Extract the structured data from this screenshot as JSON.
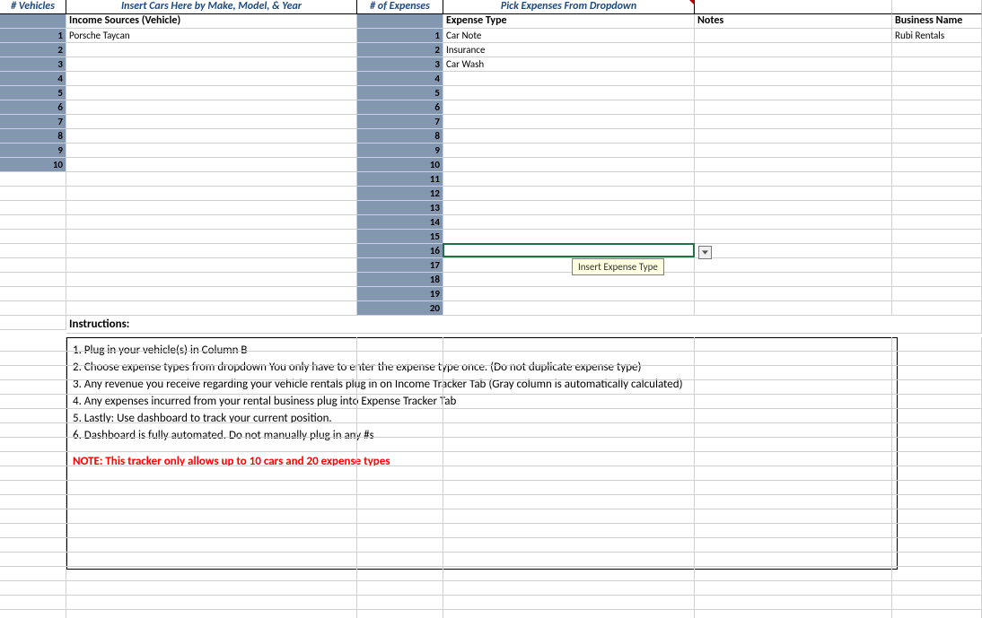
{
  "header1": {
    "vehicles": "# Vehicles",
    "insertCars": "Insert Cars Here by Make, Model, & Year",
    "numExpenses": "# of Expenses",
    "pickExpenses": "Pick Expenses From Dropdown"
  },
  "header2": {
    "incomeSources": "Income Sources (Vehicle)",
    "expenseType": "Expense Type",
    "notes": "Notes",
    "businessName": "Business Name"
  },
  "vehicles_numbers": [
    "1",
    "2",
    "3",
    "4",
    "5",
    "6",
    "7",
    "8",
    "9",
    "10"
  ],
  "vehicles_values": [
    "Porsche Taycan",
    "",
    "",
    "",
    "",
    "",
    "",
    "",
    "",
    ""
  ],
  "expense_numbers": [
    "1",
    "2",
    "3",
    "4",
    "5",
    "6",
    "7",
    "8",
    "9",
    "10",
    "11",
    "12",
    "13",
    "14",
    "15",
    "16",
    "17",
    "18",
    "19",
    "20"
  ],
  "expense_values": [
    "Car Note",
    "Insurance",
    "Car Wash",
    "",
    "",
    "",
    "",
    "",
    "",
    "",
    "",
    "",
    "",
    "",
    "",
    "",
    "",
    "",
    "",
    ""
  ],
  "notes_value": "",
  "business_name_value": "Rubi Rentals",
  "tooltip_text": "Insert Expense Type",
  "instructions_heading": "Instructions:",
  "instructions": [
    "1. Plug in your vehicle(s) in Column B",
    "2. Choose expense types from dropdown You only have to enter the expense type once. (Do not duplicate expense type)",
    "3. Any revenue you receive regarding your vehicle rentals plug in on Income Tracker Tab (Gray column is automatically calculated)",
    "4. Any expenses incurred from your rental business plug into Expense Tracker Tab",
    "5. Lastly: Use dashboard to track your current position.",
    "6. Dashboard is fully automated. Do not manually plug in any #s"
  ],
  "instructions_note": "NOTE: This tracker only allows up to 10 cars and 20 expense types"
}
